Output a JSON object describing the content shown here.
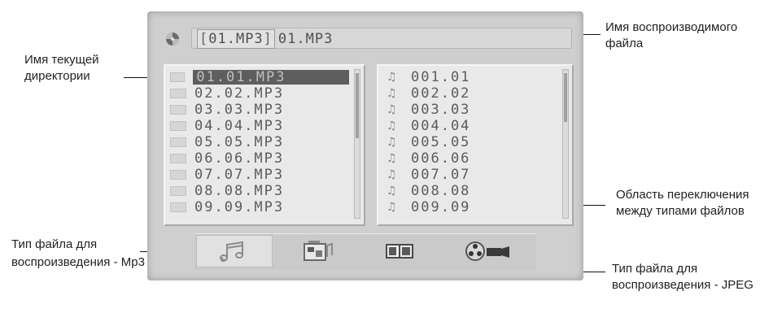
{
  "path_bar": {
    "directory": "01.MP3",
    "filename": "01.MP3",
    "open_bracket": "[",
    "close_bracket": "]"
  },
  "left_list": {
    "items": [
      "01.01.MP3",
      "02.02.MP3",
      "03.03.MP3",
      "04.04.MP3",
      "05.05.MP3",
      "06.06.MP3",
      "07.07.MP3",
      "08.08.MP3",
      "09.09.MP3"
    ],
    "selected_index": 0
  },
  "right_list": {
    "note_glyph": "♫",
    "items": [
      "001.01",
      "002.02",
      "003.03",
      "004.04",
      "005.05",
      "006.06",
      "007.07",
      "008.08",
      "009.09"
    ]
  },
  "file_types": [
    {
      "name": "music-type-icon",
      "active": true
    },
    {
      "name": "photo-type-icon",
      "active": false
    },
    {
      "name": "film-type-icon",
      "active": false
    },
    {
      "name": "video-type-icon",
      "active": false
    }
  ],
  "callouts": {
    "playing_file_name": "Имя воспроизводимого файла",
    "current_directory": "Имя текущей директории",
    "type_switch_area": "Область переключения между типами файлов",
    "type_mp3": "Тип файла для воспроизведения - Mp3",
    "type_jpeg": "Тип файла для воспроизведения - JPEG"
  },
  "colors": {
    "screen_bg": "#cfcfcf",
    "panel_bg": "#e9e9e9",
    "selection_bg": "#5e5e5e",
    "text_gray": "#5c5c5c"
  }
}
